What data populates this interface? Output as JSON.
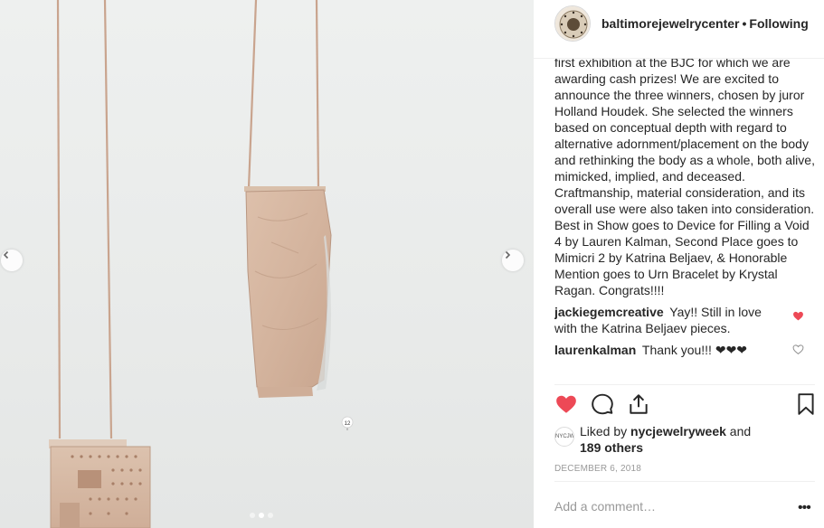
{
  "post": {
    "username": "baltimorejewelrycenter",
    "separator": "•",
    "follow_state": "Following",
    "caption": "first exhibition at the BJC for which we are awarding cash prizes! We are excited to announce the three winners, chosen by juror Holland Houdek. She selected the winners based on conceptual depth with regard to alternative adornment/placement on the body and rethinking the body as a whole, both alive, mimicked, implied, and deceased. Craftmanship, material consideration, and its overall use were also taken into consideration. Best in Show goes to Device for Filling a Void 4 by Lauren Kalman, Second Place goes to Mimicri 2 by Katrina Beljaev, & Honorable Mention goes to Urn Bracelet by Krystal Ragan. Congrats!!!!",
    "comments": [
      {
        "user": "jackiegemcreative",
        "text": "Yay!! Still in love with the Katrina Beljaev pieces.",
        "liked": true
      },
      {
        "user": "laurenkalman",
        "text": "Thank you!!! ❤❤❤",
        "liked": false
      }
    ],
    "likes": {
      "prefix": "Liked by",
      "user": "nycjewelryweek",
      "joiner": "and",
      "others": "189 others",
      "liker_avatar_text": "NYCJW"
    },
    "date": "DECEMBER 6, 2018",
    "add_comment_placeholder": "Add a comment…",
    "more_label": "•••"
  },
  "media": {
    "tag_number": "12",
    "carousel": {
      "count": 3,
      "active_index": 1
    },
    "prev_arrow": "‹",
    "next_arrow": "›"
  },
  "icons": {
    "like": "heart-filled-icon",
    "comment": "comment-bubble-icon",
    "share": "share-icon",
    "save": "bookmark-icon",
    "comment_like_on": "heart-filled-icon",
    "comment_like_off": "heart-outline-icon"
  },
  "colors": {
    "like_red": "#ed4956",
    "text": "#262626",
    "muted": "#999999",
    "border": "#efefef",
    "leather": "#d8b9a4"
  }
}
